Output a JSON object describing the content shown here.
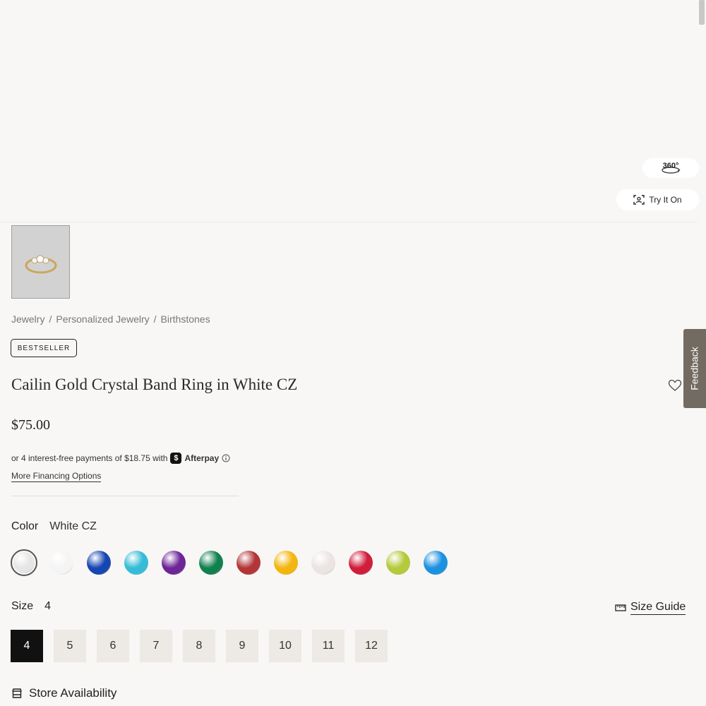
{
  "hero": {
    "view_360_label": "360°",
    "try_on_label": "Try It On"
  },
  "breadcrumb": [
    "Jewelry",
    "/",
    "Personalized Jewelry",
    "/",
    "Birthstones"
  ],
  "badge": "BESTSELLER",
  "product": {
    "title": "Cailin Gold Crystal Band Ring in White CZ",
    "price": "$75.00"
  },
  "payment": {
    "installments_text": "or 4 interest-free payments of $18.75 with",
    "provider": "Afterpay",
    "more_options": "More Financing Options"
  },
  "color": {
    "label": "Color",
    "selected": "White CZ",
    "swatches": [
      "#e6e6e6",
      "#f4f4f4",
      "#1746b3",
      "#35bcd6",
      "#6d2597",
      "#11804f",
      "#b33538",
      "#f2b60e",
      "#ece4e2",
      "#d01d3b",
      "#b5c93b",
      "#1c91df"
    ]
  },
  "size": {
    "label": "Size",
    "selected": "4",
    "guide_label": "Size Guide",
    "options": [
      "4",
      "5",
      "6",
      "7",
      "8",
      "9",
      "10",
      "11",
      "12"
    ]
  },
  "store": {
    "label": "Store Availability"
  },
  "feedback_label": "Feedback"
}
